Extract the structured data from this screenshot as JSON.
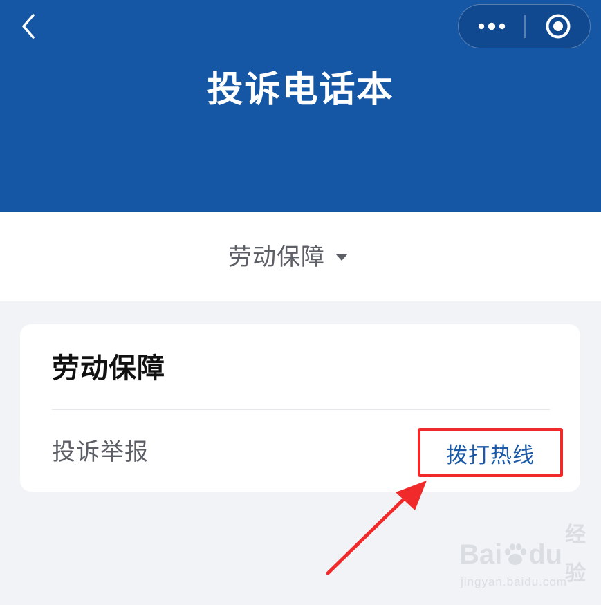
{
  "header": {
    "title": "投诉电话本",
    "back_icon": "chevron-left-icon",
    "more_icon": "more-dots-icon",
    "target_icon": "target-icon",
    "background_color": "#1557a4"
  },
  "selector": {
    "label": "劳动保障",
    "caret_icon": "caret-down-icon"
  },
  "card": {
    "title": "劳动保障",
    "row": {
      "label": "投诉举报",
      "action_label": "拨打热线",
      "action_color": "#1a5aa8"
    }
  },
  "annotation": {
    "highlight_color": "#f02a2a"
  },
  "watermark": {
    "brand_left": "Bai",
    "brand_right": "du",
    "brand_cn": "经验",
    "url": "jingyan.baidu.com"
  }
}
